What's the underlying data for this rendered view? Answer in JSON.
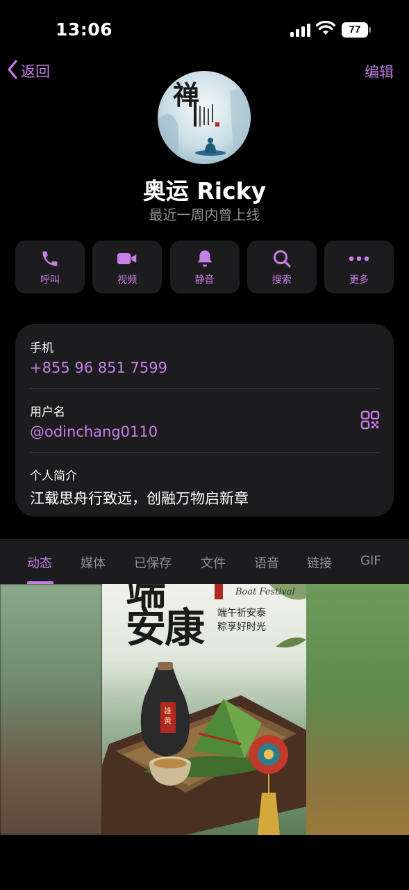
{
  "status_bar": {
    "time": "13:06",
    "battery": "77"
  },
  "nav": {
    "back_label": "返回",
    "edit_label": "编辑"
  },
  "profile": {
    "name": "奥运 Ricky",
    "status": "最近一周内曾上线"
  },
  "actions": [
    {
      "label": "呼叫",
      "icon": "phone-icon"
    },
    {
      "label": "视频",
      "icon": "video-icon"
    },
    {
      "label": "静音",
      "icon": "bell-icon"
    },
    {
      "label": "搜索",
      "icon": "search-icon"
    },
    {
      "label": "更多",
      "icon": "more-icon"
    }
  ],
  "info": {
    "phone_label": "手机",
    "phone_value": "+855 96 851 7599",
    "username_label": "用户名",
    "username_value": "@odinchang0110",
    "bio_label": "个人简介",
    "bio_value": "江载思舟行致远，创融万物启新章"
  },
  "tabs": [
    "动态",
    "媒体",
    "已保存",
    "文件",
    "语音",
    "链接",
    "GIF"
  ],
  "active_tab": "动态",
  "poster": {
    "title": "安康",
    "english": "Boat Festival",
    "line1": "端午祈安泰",
    "line2": "粽享好时光"
  },
  "colors": {
    "accent": "#c77ee6",
    "card": "#1c1c1e",
    "background": "#000000"
  }
}
